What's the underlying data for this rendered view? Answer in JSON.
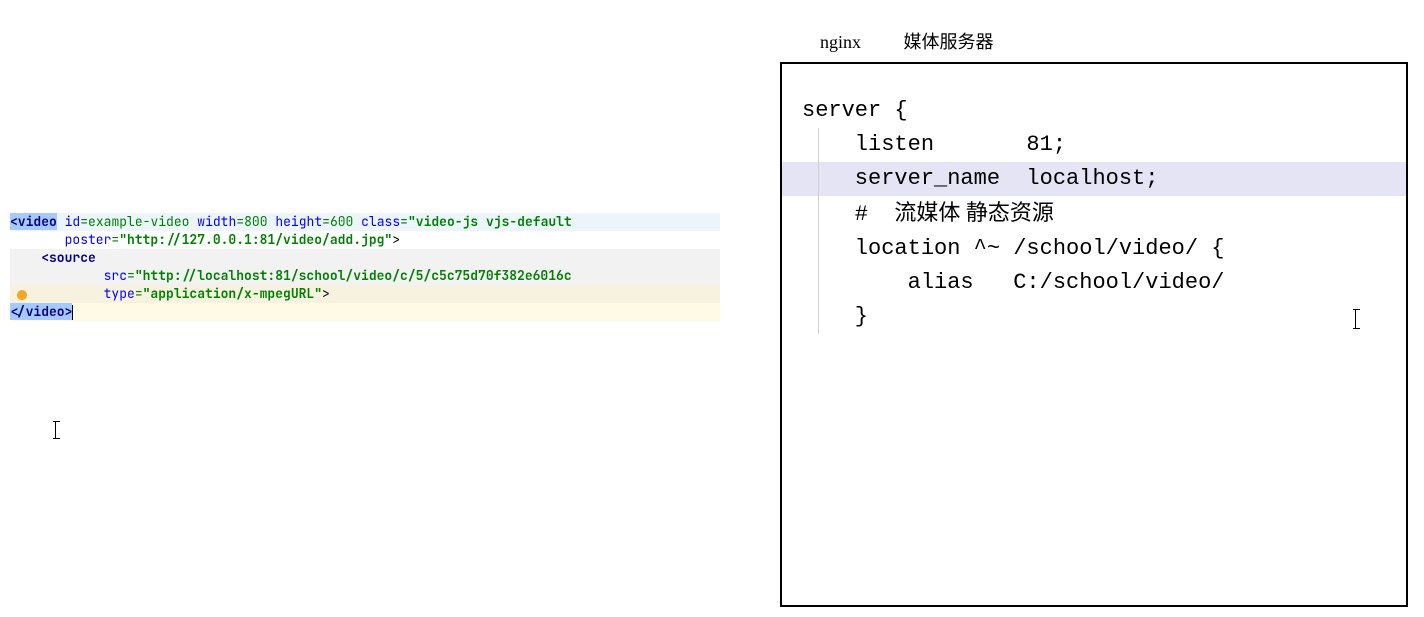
{
  "left_code": {
    "line1": {
      "tag_open": "<video",
      "attrs": " id=example-video width=800 height=600 class=",
      "id_attr": "id",
      "id_val": "example-video",
      "width_attr": "width",
      "width_val": "800",
      "height_attr": "height",
      "height_val": "600",
      "class_attr": "class",
      "class_val": "\"video-js vjs-default"
    },
    "line2": {
      "indent": "       ",
      "poster_attr": "poster",
      "poster_val": "\"http://127.0.0.1:81/video/add.jpg\"",
      "close": ">"
    },
    "line3": {
      "indent": "    ",
      "tag": "<source"
    },
    "line4": {
      "indent": "            ",
      "src_attr": "src",
      "src_val": "\"http://localhost:81/school/video/c/5/c5c75d70f382e6016c"
    },
    "line5": {
      "indent": "            ",
      "type_attr": "type",
      "type_val": "\"application/x-mpegURL\"",
      "close": ">"
    },
    "line6": {
      "tag": "</video>"
    }
  },
  "right": {
    "label_nginx": "nginx",
    "label_media": "媒体服务器",
    "nginx_code": {
      "l1": "server {",
      "empty": "",
      "l2": "    listen       81;",
      "l3": "    server_name  localhost;",
      "l_comment_prefix": "    #  ",
      "l_comment_text": "流媒体 静态资源",
      "l5": "    location ^~ /school/video/ {",
      "l6": "        alias   C:/school/video/",
      "l7": "    }"
    }
  }
}
